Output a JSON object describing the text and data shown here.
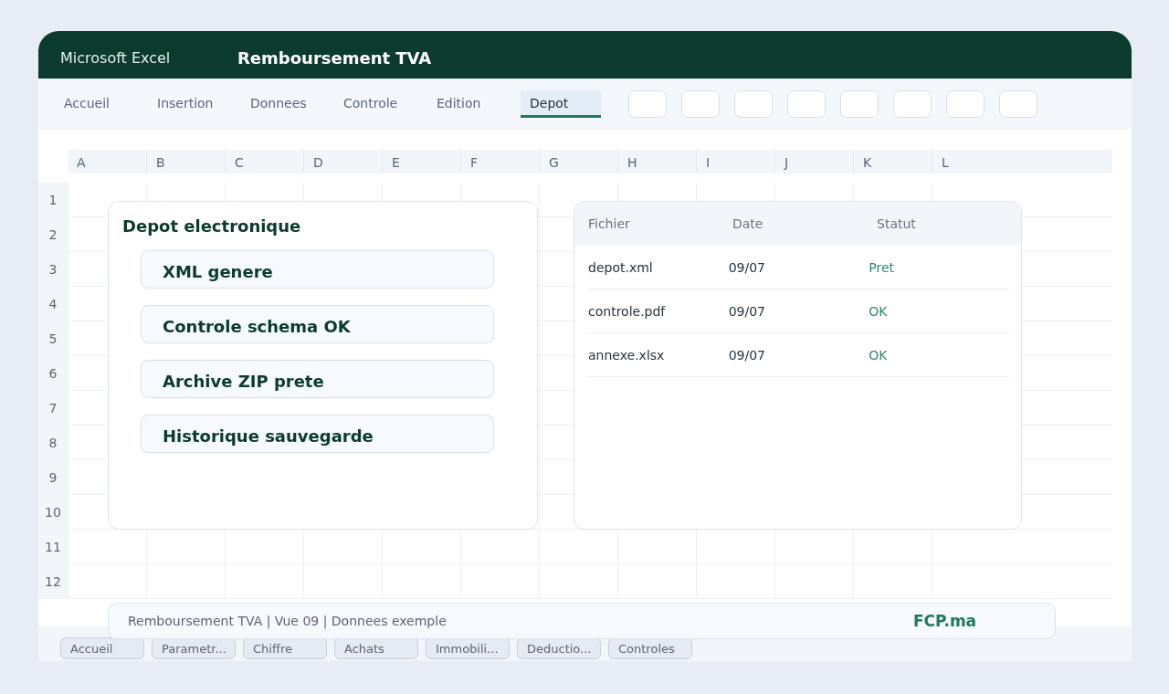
{
  "window": {
    "app": "Microsoft Excel",
    "title": "Remboursement TVA"
  },
  "ribbon_tabs": [
    {
      "label": "Accueil",
      "selected": false
    },
    {
      "label": "Insertion",
      "selected": false
    },
    {
      "label": "Donnees",
      "selected": false
    },
    {
      "label": "Controle",
      "selected": false
    },
    {
      "label": "Edition",
      "selected": false
    },
    {
      "label": "Depot",
      "selected": true
    }
  ],
  "columns": [
    "A",
    "B",
    "C",
    "D",
    "E",
    "F",
    "G",
    "H",
    "I",
    "J",
    "K",
    "L"
  ],
  "rows": [
    "1",
    "2",
    "3",
    "4",
    "5",
    "6",
    "7",
    "8",
    "9",
    "10",
    "11",
    "12"
  ],
  "depot_panel": {
    "title": "Depot electronique",
    "items": [
      "XML genere",
      "Controle schema OK",
      "Archive ZIP prete",
      "Historique sauvegarde"
    ]
  },
  "files_table": {
    "columns": [
      "Fichier",
      "Date",
      "Statut"
    ],
    "rows": [
      [
        "depot.xml",
        "09/07",
        "Pret"
      ],
      [
        "controle.pdf",
        "09/07",
        "OK"
      ],
      [
        "annexe.xlsx",
        "09/07",
        "OK"
      ]
    ]
  },
  "status_bar": {
    "text": "Remboursement TVA | Vue 09 | Donnees exemple",
    "brand": "FCP.ma"
  },
  "sheet_tabs": [
    "Accueil",
    "Parametr...",
    "Chiffre",
    "Achats",
    "Immobili...",
    "Deductio...",
    "Controles"
  ]
}
